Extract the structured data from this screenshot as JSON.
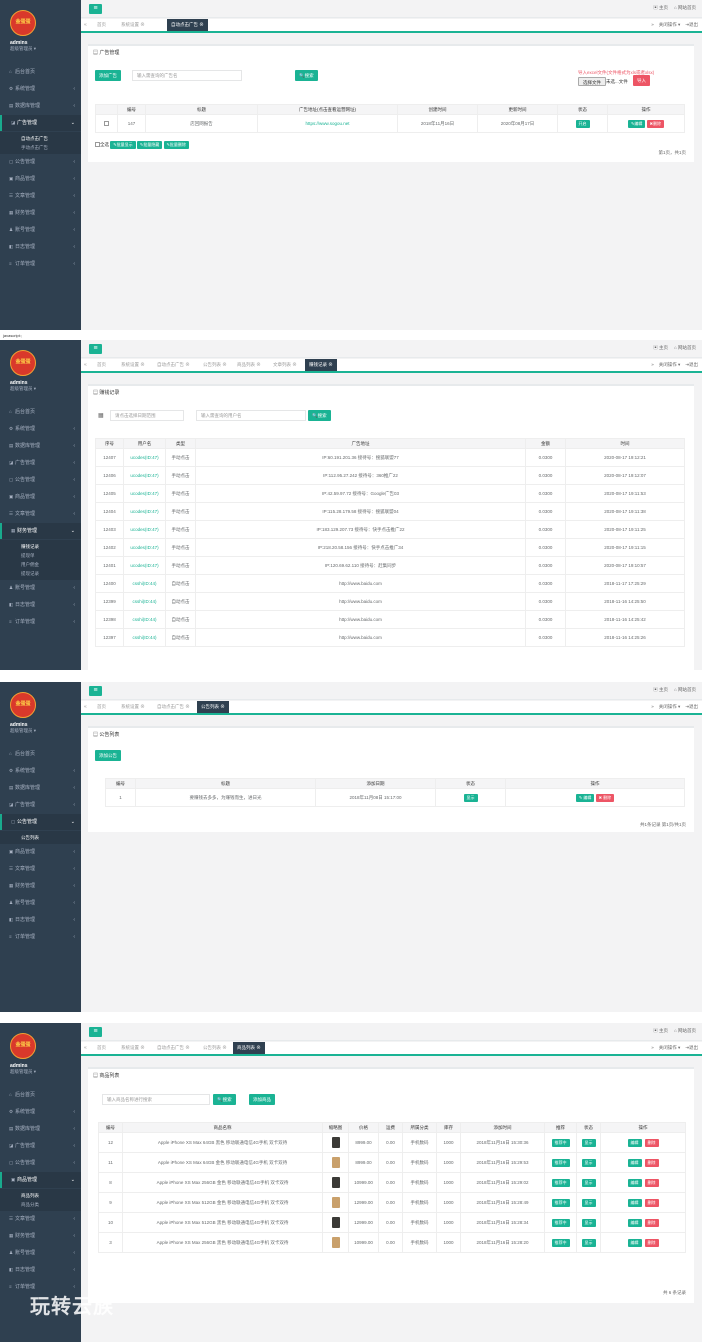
{
  "common": {
    "logo_text": "金蛋蛋",
    "user_name": "admins",
    "user_role": "超级管理员 ▾",
    "top_home": "主页",
    "top_site": "网站首页",
    "tab_close_ops": "关闭操作 ▾",
    "tab_exit": "退出"
  },
  "p1": {
    "tabs": [
      "首页",
      "系统设置 ⊗",
      "自动点击广告 ⊗"
    ],
    "nav": [
      "后台首页",
      "系统管理",
      "数据库管理",
      "广告管理",
      "公告管理",
      "商品管理",
      "文章管理",
      "财务管理",
      "账号管理",
      "日志管理",
      "订单管理"
    ],
    "sub": [
      "自动点击广告",
      "手动点击广告"
    ],
    "box_title": "广告管理",
    "add_btn": "添加广告",
    "search_placeholder": "输入需查询的广告名",
    "search_btn": "搜索",
    "import_note": "导入excel文件(文件格式为xls或者xlsx)",
    "choose_file": "选择文件",
    "no_file": "未选...文件",
    "import_btn": "导入",
    "columns": [
      "",
      "编号",
      "标题",
      "广告地址(点击查看运营网址)",
      "创建时间",
      "更新时间",
      "状态",
      "操作"
    ],
    "row": {
      "id": "147",
      "title": "店回网报告",
      "url": "https://www.sogou.net",
      "created": "2018年11月16日",
      "updated": "2020年08月17日",
      "status": "开启",
      "edit": "编辑",
      "del": "删除"
    },
    "select_all": "全选",
    "bulk": [
      "批量显示",
      "批量隐藏",
      "批量删除"
    ],
    "pager": "第1页，共1页"
  },
  "p2": {
    "tabs": [
      "首页",
      "系统设置 ⊗",
      "自动点击广告 ⊗",
      "公告列表 ⊗",
      "商品列表 ⊗",
      "文章列表 ⊗",
      "赚钱记录"
    ],
    "nav": [
      "后台首页",
      "系统管理",
      "数据库管理",
      "广告管理",
      "公告管理",
      "商品管理",
      "文章管理",
      "财务管理",
      "账号管理",
      "日志管理",
      "订单管理"
    ],
    "sub": [
      "赚钱记录",
      "提现单",
      "用户佣金",
      "提现记录"
    ],
    "box_title": "赚钱记录",
    "date_placeholder": "请点击选择日期范围",
    "user_placeholder": "输入需查询的用户名",
    "search_btn": "搜索",
    "columns": [
      "序号",
      "用户名",
      "类型",
      "广告地址",
      "金额",
      "时间"
    ],
    "rows": [
      [
        "12407",
        "ucodes(ID:47)",
        "手动点击",
        "IP:60.191.201.36 接待号：搜狐联盟77",
        "0.0300",
        "2020-08-17 19:12:21"
      ],
      [
        "12406",
        "ucodes(ID:47)",
        "手动点击",
        "IP:112.95.27.242 接待号：360推广22",
        "0.0300",
        "2020-08-17 19:12:07"
      ],
      [
        "12405",
        "ucodes(ID:47)",
        "手动点击",
        "IP:42.59.97.72 接待号：Google广告03",
        "0.0300",
        "2020-08-17 19:11:53"
      ],
      [
        "12404",
        "ucodes(ID:47)",
        "手动点击",
        "IP:115.28.179.58 接待号：搜狐联盟04",
        "0.0300",
        "2020-08-17 19:11:38"
      ],
      [
        "12403",
        "ucodes(ID:47)",
        "手动点击",
        "IP:183.129.207.73 接待号：快手点击推广22",
        "0.0300",
        "2020-08-17 19:11:25"
      ],
      [
        "12402",
        "ucodes(ID:47)",
        "手动点击",
        "IP:218.20.58.156 接待号：快手点击推广34",
        "0.0300",
        "2020-08-17 19:11:15"
      ],
      [
        "12401",
        "ucodes(ID:47)",
        "手动点击",
        "IP:120.69.62.110 接待号：赶集同步",
        "0.0300",
        "2020-08-17 19:10:57"
      ],
      [
        "12400",
        "csshi(ID:44)",
        "自动点击",
        "http://www.baidu.com",
        "0.0300",
        "2018-11-17 17:25:29"
      ],
      [
        "12399",
        "csshi(ID:44)",
        "自动点击",
        "http://www.baidu.com",
        "0.0300",
        "2018-11-16 14:25:50"
      ],
      [
        "12398",
        "csshi(ID:44)",
        "自动点击",
        "http://www.baidu.com",
        "0.0300",
        "2018-11-16 14:25:42"
      ],
      [
        "12397",
        "csshi(ID:44)",
        "自动点击",
        "http://www.baidu.com",
        "0.0300",
        "2018-11-16 14:25:26"
      ]
    ]
  },
  "p3": {
    "tabs": [
      "首页",
      "系统设置 ⊗",
      "自动点击广告 ⊗",
      "公告列表"
    ],
    "nav": [
      "后台首页",
      "系统管理",
      "数据库管理",
      "广告管理",
      "公告管理",
      "商品管理",
      "文章管理",
      "财务管理",
      "账号管理",
      "日志管理",
      "订单管理"
    ],
    "sub": [
      "公告列表"
    ],
    "box_title": "公告列表",
    "add_btn": "添加公告",
    "columns": [
      "编号",
      "标题",
      "添加日期",
      "状态",
      "操作"
    ],
    "row": {
      "id": "1",
      "title": "要赚钱去多多，为赚钱而生，进日光",
      "date": "2018年11月08日 15:17:00",
      "status": "显示",
      "edit": "编辑",
      "del": "删除"
    },
    "pager": "共1条记录 第1页/共1页"
  },
  "p4": {
    "tabs": [
      "首页",
      "系统设置 ⊗",
      "自动点击广告 ⊗",
      "公告列表 ⊗",
      "商品列表"
    ],
    "nav": [
      "后台首页",
      "系统管理",
      "数据库管理",
      "广告管理",
      "公告管理",
      "商品管理",
      "文章管理",
      "财务管理",
      "账号管理",
      "日志管理",
      "订单管理"
    ],
    "sub": [
      "商品列表",
      "商品分类"
    ],
    "box_title": "商品列表",
    "search_placeholder": "输入商品名称进行搜索",
    "search_btn": "搜索",
    "add_btn": "添加商品",
    "columns": [
      "编号",
      "商品名称",
      "缩略图",
      "价格",
      "运费",
      "所属分类",
      "库存",
      "添加时间",
      "推荐",
      "状态",
      "操作"
    ],
    "rows": [
      [
        "12",
        "Apple iPhone XS Max 64GB 黑色 移动联通电信4G手机 双卡双待",
        "8999.00",
        "0.00",
        "手机数码",
        "1000",
        "2018年11月16日 15:30:36"
      ],
      [
        "11",
        "Apple iPhone XS Max 64GB 金色 移动联通电信4G手机 双卡双待",
        "8999.00",
        "0.00",
        "手机数码",
        "1000",
        "2018年11月16日 15:29:53"
      ],
      [
        "8",
        "Apple iPhone XS Max 256GB 金色 移动联通电信4G手机 双卡双待",
        "10999.00",
        "0.00",
        "手机数码",
        "1000",
        "2018年11月16日 15:29:02"
      ],
      [
        "9",
        "Apple iPhone XS Max 512GB 金色 移动联通电信4G手机 双卡双待",
        "12999.00",
        "0.00",
        "手机数码",
        "1000",
        "2018年11月16日 15:28:49"
      ],
      [
        "10",
        "Apple iPhone XS Max 512GB 黑色 移动联通电信4G手机 双卡双待",
        "12999.00",
        "0.00",
        "手机数码",
        "1000",
        "2018年11月16日 15:28:34"
      ],
      [
        "3",
        "Apple iPhone XS Max 256GB 黑色 移动联通电信4G手机 双卡双待",
        "10999.00",
        "0.00",
        "手机数码",
        "1000",
        "2018年11月16日 15:28:20"
      ]
    ],
    "rec_label": "推荐中",
    "status_label": "显示",
    "edit": "编辑",
    "del": "删除",
    "pager": "共 6 条记录"
  },
  "watermark": "玩转云族",
  "js_label": "javascript:;"
}
